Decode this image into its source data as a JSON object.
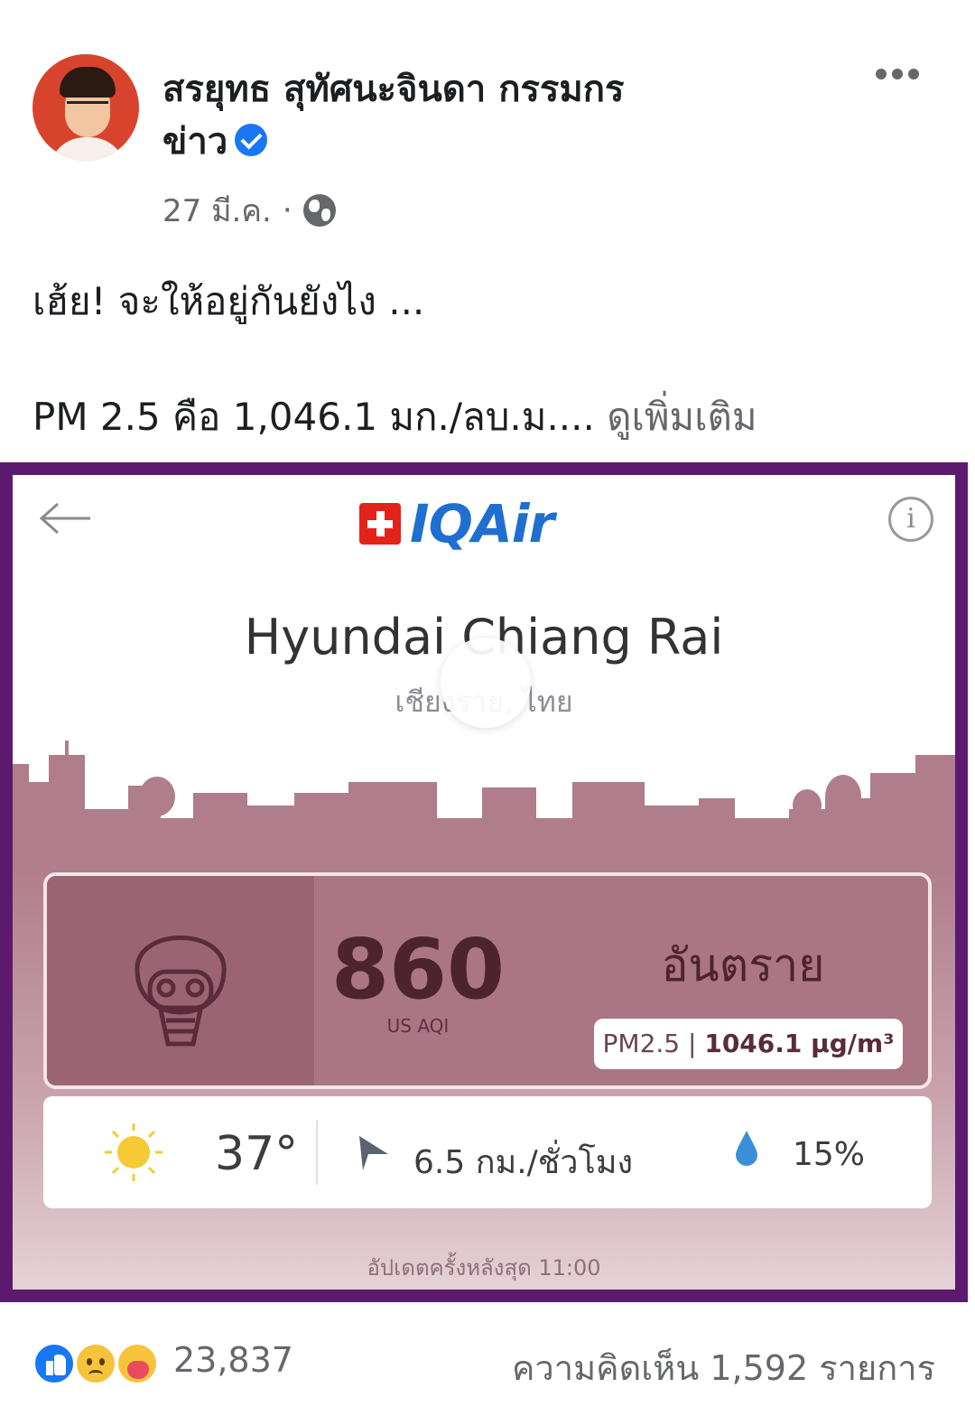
{
  "post": {
    "author_line1": "สรยุทธ สุทัศนะจินดา กรรมกร",
    "author_line2": "ข่าว",
    "date": "27 มี.ค.",
    "separator": "·",
    "text_line1": "เฮ้ย! จะให้อยู่กันยังไง ...",
    "text_line2": "PM 2.5 คือ 1,046.1 มก./ลบ.ม....",
    "see_more": "ดูเพิ่มเติม"
  },
  "image": {
    "logo_text": "IQAir",
    "station": "Hyundai Chiang Rai",
    "region": "เชียงราย, ไทย",
    "aqi_value": "860",
    "aqi_label": "US AQI",
    "status": "อันตราย",
    "pm_label": "PM2.5 |",
    "pm_value": "1046.1 µg/m³",
    "temperature": "37°",
    "wind": "6.5 กม./ชั่วโมง",
    "humidity": "15%",
    "updated": "อัปเดตครั้งหลังสุด 11:00",
    "info_icon": "i",
    "colors": {
      "frame": "#5b1a6e",
      "aqi_card": "#aa7585",
      "logo_blue": "#1f6fd1",
      "swiss_red": "#e2231a"
    }
  },
  "footer": {
    "reaction_count": "23,837",
    "comments": "ความคิดเห็น 1,592 รายการ",
    "reaction_icons": [
      "like-icon",
      "sad-icon",
      "care-icon"
    ]
  }
}
